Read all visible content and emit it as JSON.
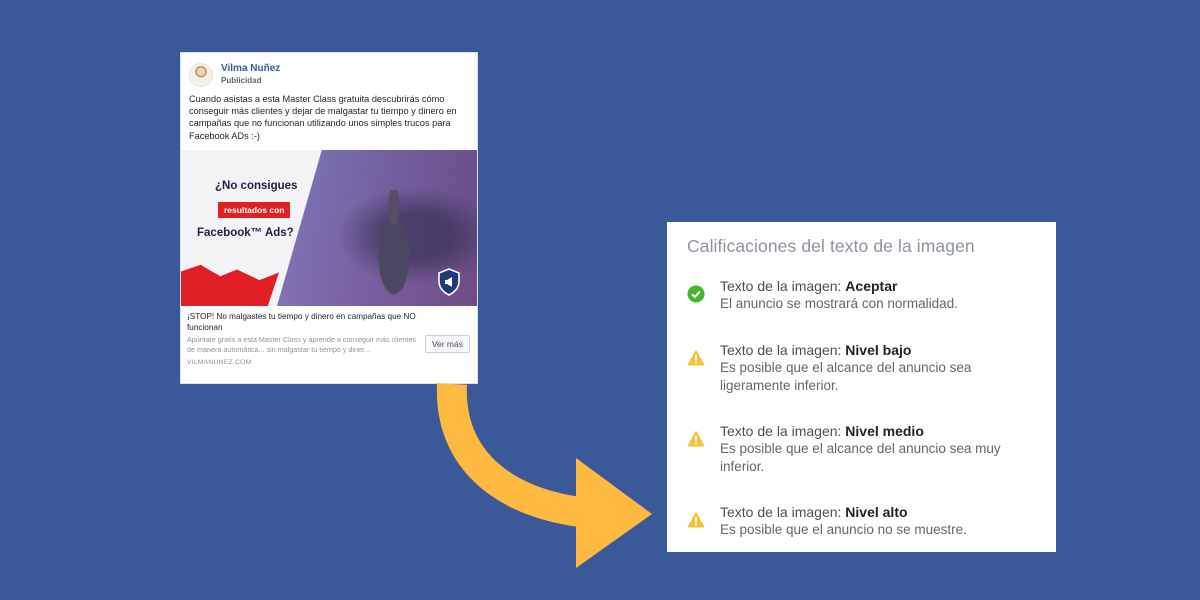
{
  "colors": {
    "background": "#3b5898",
    "arrow": "#fdb940",
    "ok_green": "#42b72a",
    "warning_yellow": "#f5c33b",
    "brand_red": "#e01f26"
  },
  "ad": {
    "author": "Vilma Nuñez",
    "sponsored": "Publicidad",
    "body": "Cuando asistas a esta Master Class gratuita descubrirás cómo conseguir más clientes y dejar de malgastar tu tiempo y dinero en campañas que no funcionan utilizando unos simples trucos para Facebook ADs :-)",
    "image": {
      "headline_1": "¿No consigues",
      "badge": "resultados con",
      "headline_2": "Facebook™ Ads?"
    },
    "link_title": "¡STOP! No malgastes tu tiempo y dinero en campañas que NO funcionan",
    "link_description": "Apúntate gratis a esta Master Class y aprende a conseguir más clientes de manera automática... sin malgastar tu tiempo y diner...",
    "domain": "VILMANUNEZ.COM",
    "see_more": "Ver más"
  },
  "ratings": {
    "title": "Calificaciones del texto de la imagen",
    "items": [
      {
        "icon": "check-circle-icon",
        "label_prefix": "Texto de la imagen: ",
        "level": "Aceptar",
        "description": "El anuncio se mostrará con normalidad."
      },
      {
        "icon": "warning-icon",
        "label_prefix": "Texto de la imagen: ",
        "level": "Nivel bajo",
        "description": "Es posible que el alcance del anuncio sea ligeramente inferior."
      },
      {
        "icon": "warning-icon",
        "label_prefix": "Texto de la imagen: ",
        "level": "Nivel medio",
        "description": "Es posible que el alcance del anuncio sea muy inferior."
      },
      {
        "icon": "warning-icon",
        "label_prefix": "Texto de la imagen: ",
        "level": "Nivel alto",
        "description": "Es posible que el anuncio no se muestre."
      }
    ]
  }
}
